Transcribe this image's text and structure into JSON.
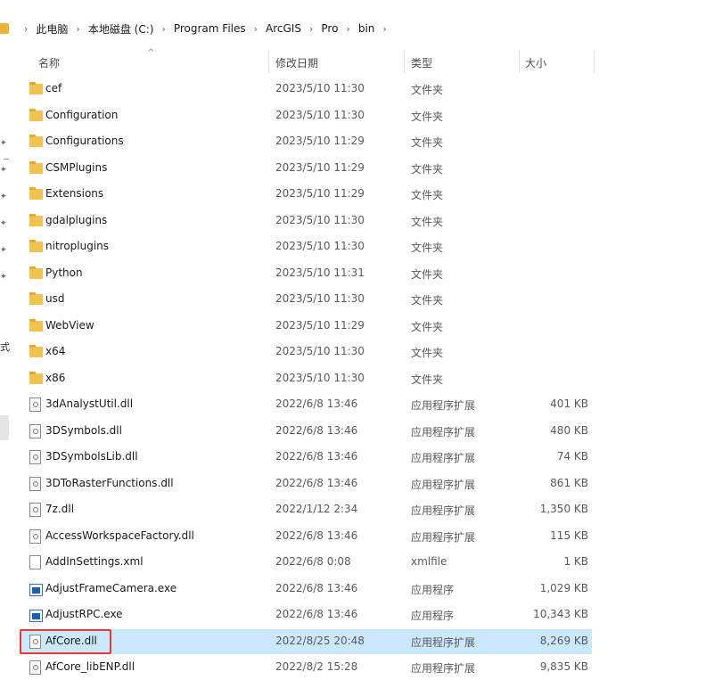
{
  "breadcrumb": [
    "此电脑",
    "本地磁盘 (C:)",
    "Program Files",
    "ArcGIS",
    "Pro",
    "bin"
  ],
  "columns": {
    "name": "名称",
    "date": "修改日期",
    "type": "类型",
    "size": "大小"
  },
  "left_pane_text": "式",
  "files": [
    {
      "name": "cef",
      "date": "2023/5/10 11:30",
      "type": "文件夹",
      "size": "",
      "icon": "folder-icon"
    },
    {
      "name": "Configuration",
      "date": "2023/5/10 11:30",
      "type": "文件夹",
      "size": "",
      "icon": "folder-icon"
    },
    {
      "name": "Configurations",
      "date": "2023/5/10 11:29",
      "type": "文件夹",
      "size": "",
      "icon": "folder-icon"
    },
    {
      "name": "CSMPlugins",
      "date": "2023/5/10 11:29",
      "type": "文件夹",
      "size": "",
      "icon": "folder-icon"
    },
    {
      "name": "Extensions",
      "date": "2023/5/10 11:29",
      "type": "文件夹",
      "size": "",
      "icon": "folder-icon"
    },
    {
      "name": "gdalplugins",
      "date": "2023/5/10 11:30",
      "type": "文件夹",
      "size": "",
      "icon": "folder-icon"
    },
    {
      "name": "nitroplugins",
      "date": "2023/5/10 11:30",
      "type": "文件夹",
      "size": "",
      "icon": "folder-icon"
    },
    {
      "name": "Python",
      "date": "2023/5/10 11:31",
      "type": "文件夹",
      "size": "",
      "icon": "folder-icon"
    },
    {
      "name": "usd",
      "date": "2023/5/10 11:30",
      "type": "文件夹",
      "size": "",
      "icon": "folder-icon"
    },
    {
      "name": "WebView",
      "date": "2023/5/10 11:29",
      "type": "文件夹",
      "size": "",
      "icon": "folder-icon"
    },
    {
      "name": "x64",
      "date": "2023/5/10 11:30",
      "type": "文件夹",
      "size": "",
      "icon": "folder-icon"
    },
    {
      "name": "x86",
      "date": "2023/5/10 11:30",
      "type": "文件夹",
      "size": "",
      "icon": "folder-icon"
    },
    {
      "name": "3dAnalystUtil.dll",
      "date": "2022/6/8 13:46",
      "type": "应用程序扩展",
      "size": "401 KB",
      "icon": "dll-icon"
    },
    {
      "name": "3DSymbols.dll",
      "date": "2022/6/8 13:46",
      "type": "应用程序扩展",
      "size": "480 KB",
      "icon": "dll-icon"
    },
    {
      "name": "3DSymbolsLib.dll",
      "date": "2022/6/8 13:46",
      "type": "应用程序扩展",
      "size": "74 KB",
      "icon": "dll-icon"
    },
    {
      "name": "3DToRasterFunctions.dll",
      "date": "2022/6/8 13:46",
      "type": "应用程序扩展",
      "size": "861 KB",
      "icon": "dll-icon"
    },
    {
      "name": "7z.dll",
      "date": "2022/1/12 2:34",
      "type": "应用程序扩展",
      "size": "1,350 KB",
      "icon": "dll-icon"
    },
    {
      "name": "AccessWorkspaceFactory.dll",
      "date": "2022/6/8 13:46",
      "type": "应用程序扩展",
      "size": "115 KB",
      "icon": "dll-icon"
    },
    {
      "name": "AddInSettings.xml",
      "date": "2022/6/8 0:08",
      "type": "xmlfile",
      "size": "1 KB",
      "icon": "xml-icon"
    },
    {
      "name": "AdjustFrameCamera.exe",
      "date": "2022/6/8 13:46",
      "type": "应用程序",
      "size": "1,029 KB",
      "icon": "exe-icon"
    },
    {
      "name": "AdjustRPC.exe",
      "date": "2022/6/8 13:46",
      "type": "应用程序",
      "size": "10,343 KB",
      "icon": "exe-icon"
    },
    {
      "name": "AfCore.dll",
      "date": "2022/8/25 20:48",
      "type": "应用程序扩展",
      "size": "8,269 KB",
      "icon": "dll-icon",
      "selected": true
    },
    {
      "name": "AfCore_libENP.dll",
      "date": "2022/8/2 15:28",
      "type": "应用程序扩展",
      "size": "9,835 KB",
      "icon": "dll-icon"
    }
  ],
  "colors": {
    "selection": "#cce8ff",
    "highlight_border": "#e53935",
    "folder": "#f0c350"
  }
}
